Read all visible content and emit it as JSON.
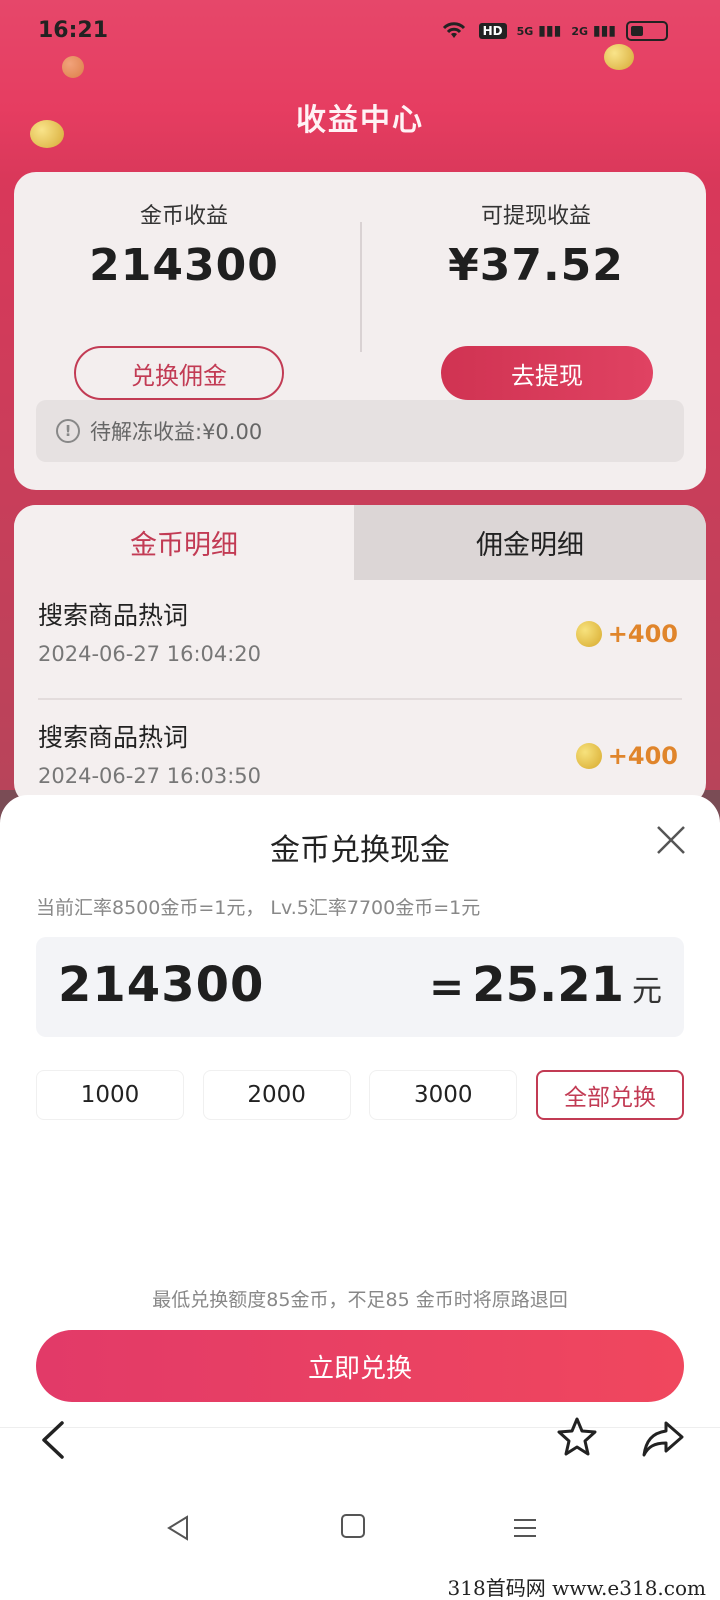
{
  "status_bar": {
    "time": "16:21",
    "network_1": "5G",
    "network_2": "2G",
    "hd_label": "HD"
  },
  "header": {
    "title": "收益中心"
  },
  "summary": {
    "coin_label": "金币收益",
    "coin_value": "214300",
    "cash_label": "可提现收益",
    "cash_value": "¥37.52",
    "exchange_button": "兑换佣金",
    "withdraw_button": "去提现",
    "pending_text": "待解冻收益:¥0.00"
  },
  "detail": {
    "tabs": [
      {
        "label": "金币明细"
      },
      {
        "label": "佣金明细"
      }
    ],
    "records": [
      {
        "title": "搜索商品热词",
        "time": "2024-06-27 16:04:20",
        "amount": "+400"
      },
      {
        "title": "搜索商品热词",
        "time": "2024-06-27 16:03:50",
        "amount": "+400"
      }
    ]
  },
  "sheet": {
    "title": "金币兑换现金",
    "rate_text": "当前汇率8500金币=1元， Lv.5汇率7700金币=1元",
    "input_value": "214300",
    "equals": "=",
    "result_value": "25.21",
    "unit": "元",
    "quick_options": [
      "1000",
      "2000",
      "3000",
      "全部兑换"
    ],
    "min_text": "最低兑换额度85金币，不足85 金币时将原路退回",
    "confirm_button": "立即兑换"
  },
  "watermark": "318首码网  www.e318.com",
  "colors": {
    "accent": "#c23b54",
    "header_bg": "#e6476a",
    "button_gradient_start": "#e23a68",
    "button_gradient_end": "#f0475e",
    "coin_amount": "#e0852b"
  }
}
